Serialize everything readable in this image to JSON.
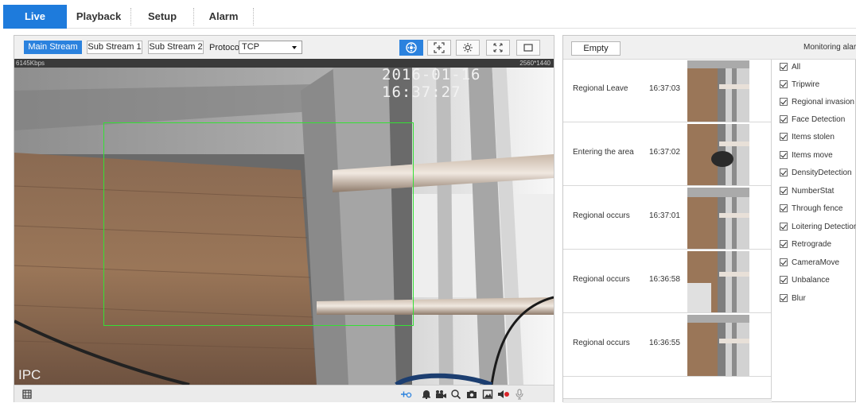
{
  "nav": {
    "tabs": [
      {
        "label": "Live",
        "active": true
      },
      {
        "label": "Playback",
        "active": false
      },
      {
        "label": "Setup",
        "active": false
      },
      {
        "label": "Alarm",
        "active": false
      }
    ]
  },
  "video_toolbar": {
    "streams": [
      "Main Stream",
      "Sub Stream 1",
      "Sub Stream 2"
    ],
    "active_stream": "Main Stream",
    "protocol_label": "Protocol",
    "protocol_value": "TCP",
    "icons": [
      "ptz-icon",
      "zoom-region-icon",
      "brightness-icon",
      "fullscreen-icon",
      "window-icon"
    ]
  },
  "video": {
    "bitrate": "6145Kbps",
    "resolution": "2560*1440",
    "timestamp": "2016-01-16 16:37:27",
    "watermark": "IPC"
  },
  "video_bottom": {
    "left_icon": "film-icon",
    "right_icons": [
      "ptz-point-icon",
      "alarm-bell-icon",
      "record-icon",
      "search-zoom-icon",
      "snapshot-icon",
      "image-icon",
      "audio-icon",
      "microphone-icon"
    ]
  },
  "events": {
    "empty_label": "Empty",
    "monitoring_label": "Monitoring alarm",
    "rows": [
      {
        "name": "Regional Leave",
        "time": "16:37:03"
      },
      {
        "name": "Entering the area",
        "time": "16:37:02"
      },
      {
        "name": "Regional occurs",
        "time": "16:37:01"
      },
      {
        "name": "Regional occurs",
        "time": "16:36:58"
      },
      {
        "name": "Regional occurs",
        "time": "16:36:55"
      }
    ],
    "filters": [
      {
        "label": "All",
        "checked": true
      },
      {
        "label": "Tripwire",
        "checked": true
      },
      {
        "label": "Regional invasion",
        "checked": true
      },
      {
        "label": "Face Detection",
        "checked": true
      },
      {
        "label": "Items stolen",
        "checked": true
      },
      {
        "label": "Items move",
        "checked": true
      },
      {
        "label": "DensityDetection",
        "checked": true
      },
      {
        "label": "NumberStat",
        "checked": true
      },
      {
        "label": "Through fence",
        "checked": true
      },
      {
        "label": "Loitering Detection",
        "checked": true
      },
      {
        "label": "Retrograde",
        "checked": true
      },
      {
        "label": "CameraMove",
        "checked": true
      },
      {
        "label": "Unbalance",
        "checked": true
      },
      {
        "label": "Blur",
        "checked": true
      }
    ]
  },
  "colors": {
    "accent": "#1e7bdc",
    "detection_box": "#35e035"
  }
}
